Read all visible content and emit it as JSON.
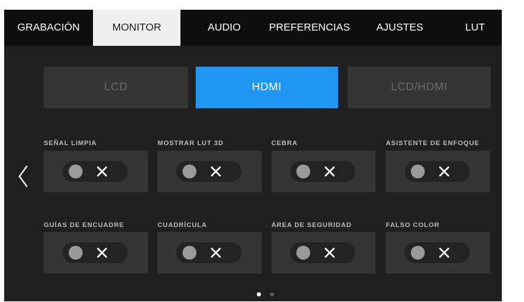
{
  "tabs": [
    {
      "label": "GRABACIÓN",
      "active": false
    },
    {
      "label": "MONITOR",
      "active": true
    },
    {
      "label": "AUDIO",
      "active": false
    },
    {
      "label": "PREFERENCIAS",
      "active": false
    },
    {
      "label": "AJUSTES",
      "active": false
    },
    {
      "label": "LUT",
      "active": false
    }
  ],
  "outputs": [
    {
      "label": "LCD",
      "selected": false
    },
    {
      "label": "HDMI",
      "selected": true
    },
    {
      "label": "LCD/HDMI",
      "selected": false
    }
  ],
  "settings": [
    {
      "label": "SEÑAL LIMPIA",
      "enabled": false
    },
    {
      "label": "MOSTRAR LUT 3D",
      "enabled": false
    },
    {
      "label": "CEBRA",
      "enabled": false
    },
    {
      "label": "ASISTENTE DE ENFOQUE",
      "enabled": false
    },
    {
      "label": "GUÍAS DE ENCUADRE",
      "enabled": false
    },
    {
      "label": "CUADRÍCULA",
      "enabled": false
    },
    {
      "label": "ÁREA DE SEGURIDAD",
      "enabled": false
    },
    {
      "label": "FALSO COLOR",
      "enabled": false
    }
  ],
  "pagination": {
    "current": 1,
    "total": 2
  },
  "colors": {
    "accent": "#1f97f2",
    "background": "#1f1f1f",
    "tab_bar": "#0e0e0e",
    "active_tab": "#efefef",
    "button": "#353535"
  },
  "icons": {
    "prev": "chevron-left-icon",
    "next": "chevron-right-icon",
    "off_state": "close-icon"
  }
}
